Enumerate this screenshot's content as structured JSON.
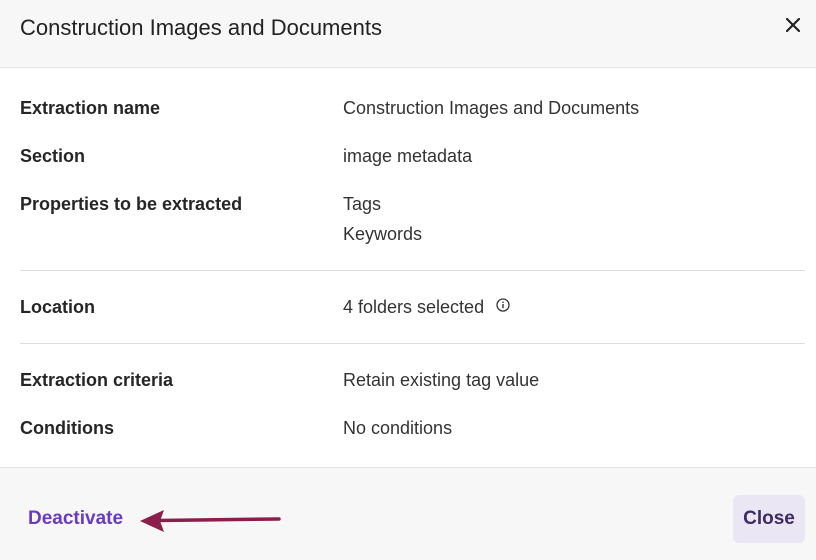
{
  "modal": {
    "title": "Construction Images and Documents",
    "close_icon": "close-icon"
  },
  "details": {
    "extraction_name": {
      "label": "Extraction name",
      "value": "Construction Images and Documents"
    },
    "section": {
      "label": "Section",
      "value": "image metadata"
    },
    "properties": {
      "label": "Properties to be extracted",
      "values": [
        "Tags",
        "Keywords"
      ]
    },
    "location": {
      "label": "Location",
      "value": "4 folders selected",
      "icon": "info-icon"
    },
    "criteria": {
      "label": "Extraction criteria",
      "value": "Retain existing tag value"
    },
    "conditions": {
      "label": "Conditions",
      "value": "No conditions"
    }
  },
  "footer": {
    "deactivate_label": "Deactivate",
    "close_label": "Close",
    "annotation_icon": "arrow-left-icon"
  },
  "colors": {
    "accent": "#6a3bc0",
    "close_button_bg": "#ebe6f3",
    "arrow": "#8b1e4a",
    "header_bg": "#f7f7f7"
  }
}
